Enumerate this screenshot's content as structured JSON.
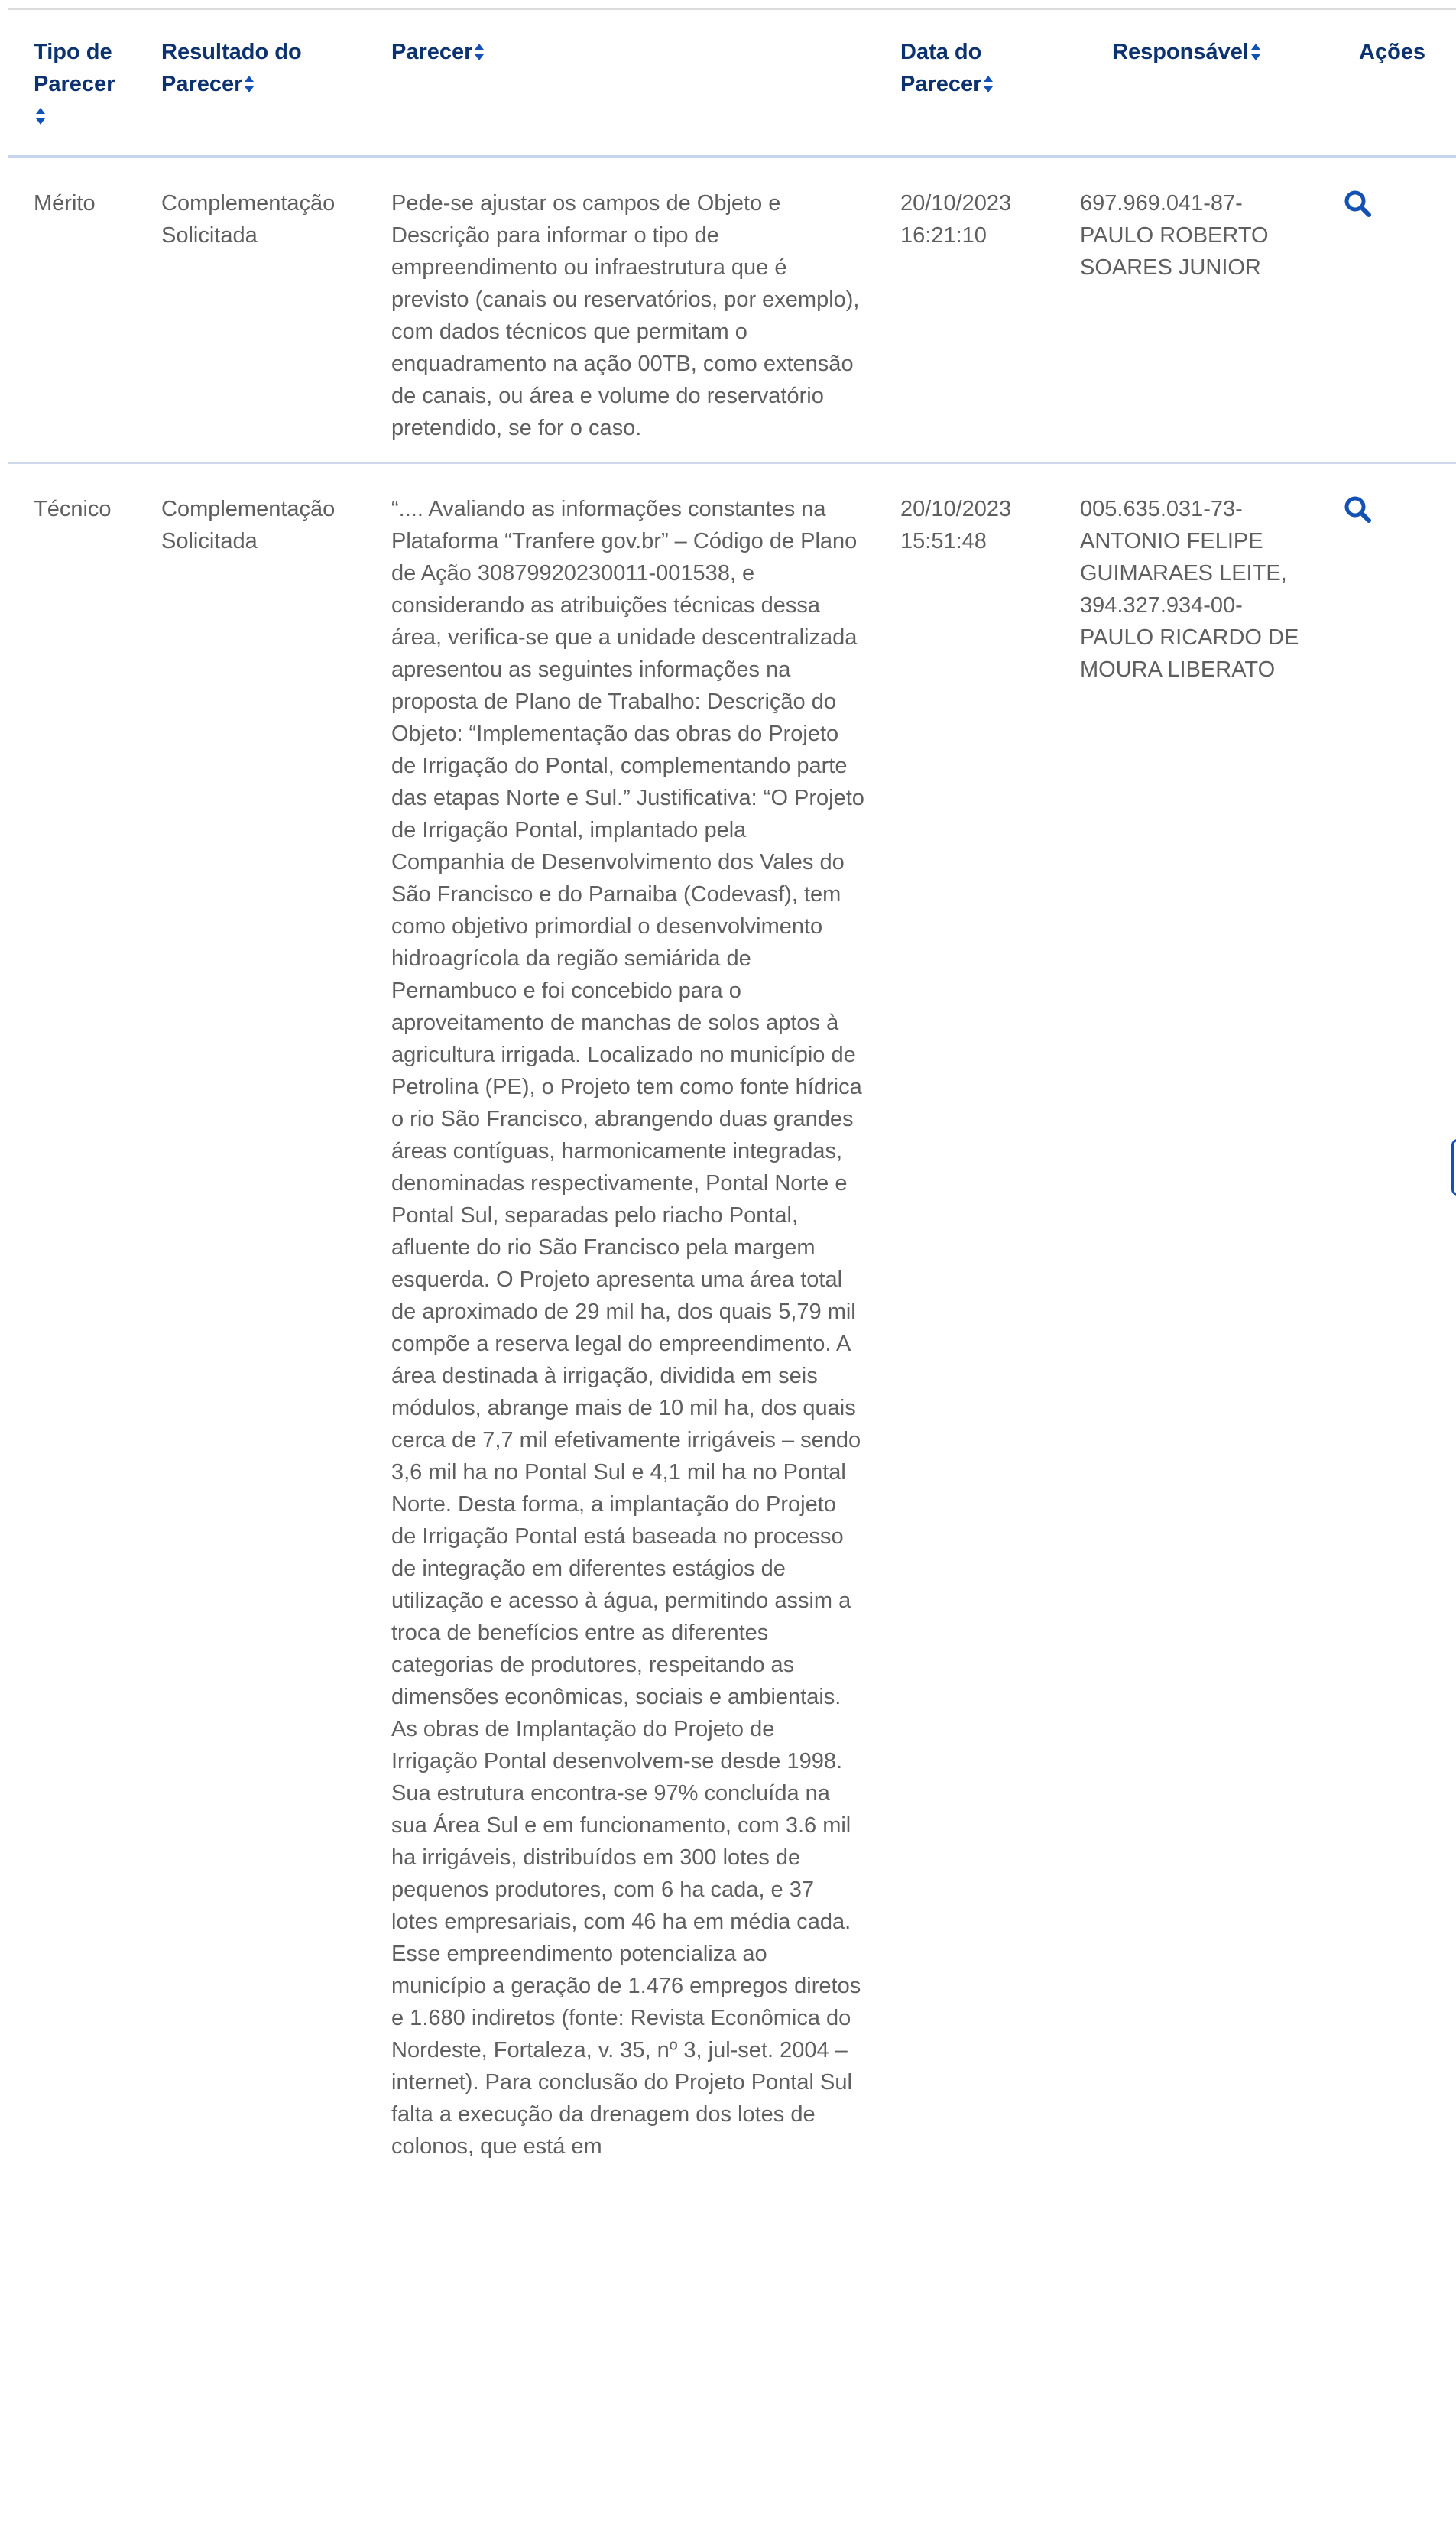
{
  "table": {
    "headers": {
      "tipo": "Tipo de Parecer",
      "resultado": "Resultado do Parecer",
      "parecer": "Parecer",
      "data": "Data do Parecer",
      "responsavel": "Responsável",
      "acoes": "Ações"
    },
    "rows": [
      {
        "tipo": "Mérito",
        "resultado": "Complementação Solicitada",
        "parecer": "Pede-se ajustar os campos de Objeto e Descrição para informar o tipo de empreendimento ou infraestrutura que é previsto (canais ou reservatórios, por exemplo), com dados técnicos que permitam o enquadramento na ação 00TB, como extensão de canais, ou área e volume do reservatório pretendido, se for o caso.",
        "data": "20/10/2023 16:21:10",
        "responsavel": "697.969.041-87- PAULO ROBERTO SOARES JUNIOR"
      },
      {
        "tipo": "Técnico",
        "resultado": "Complementação Solicitada",
        "parecer": "“.... Avaliando as informações constantes na Plataforma “Tranfere gov.br” – Código de Plano de Ação 30879920230011-001538, e considerando as atribuições técnicas dessa área, verifica-se que a unidade descentralizada apresentou as seguintes informações na proposta de Plano de Trabalho: Descrição do Objeto: “Implementação das obras do Projeto de Irrigação do Pontal, complementando parte das etapas Norte e Sul.” Justificativa: “O Projeto de Irrigação Pontal, implantado pela Companhia de Desenvolvimento dos Vales do São Francisco e do Parnaiba (Codevasf), tem como objetivo primordial o desenvolvimento hidroagrícola da região semiárida de Pernambuco e foi concebido para o aproveitamento de manchas de solos aptos à agricultura irrigada. Localizado no município de Petrolina (PE), o Projeto tem como fonte hídrica o rio São Francisco, abrangendo duas grandes áreas contíguas, harmonicamente integradas, denominadas respectivamente, Pontal Norte e Pontal Sul, separadas pelo riacho Pontal, afluente do rio São Francisco pela margem esquerda. O Projeto apresenta uma área total de aproximado de 29 mil ha, dos quais 5,79 mil compõe a reserva legal do empreendimento. A área destinada à irrigação, dividida em seis módulos, abrange mais de 10 mil ha, dos quais cerca de 7,7 mil efetivamente irrigáveis – sendo 3,6 mil ha no Pontal Sul e 4,1 mil ha no Pontal Norte. Desta forma, a implantação do Projeto de Irrigação Pontal está baseada no processo de integração em diferentes estágios de utilização e acesso à água, permitindo assim a troca de benefícios entre as diferentes categorias de produtores, respeitando as dimensões econômicas, sociais e ambientais. As obras de Implantação do Projeto de Irrigação Pontal desenvolvem-se desde 1998. Sua estrutura encontra-se 97% concluída na sua Área Sul e em funcionamento, com 3.6 mil ha irrigáveis, distribuídos em 300 lotes de pequenos produtores, com 6 ha cada, e 37 lotes empresariais, com 46 ha em média cada. Esse empreendimento potencializa ao município a geração de 1.476 empregos diretos e 1.680 indiretos (fonte: Revista Econômica do Nordeste, Fortaleza, v. 35, nº 3, jul-set. 2004 – internet). Para conclusão do Projeto Pontal Sul falta a execução da drenagem dos lotes de colonos, que está em",
        "data": "20/10/2023 15:51:48",
        "responsavel": "005.635.031-73- ANTONIO FELIPE GUIMARAES LEITE, 394.327.934-00- PAULO RICARDO DE MOURA LIBERATO"
      }
    ]
  },
  "icons": {
    "sort": "sort-icon",
    "action": "search-icon"
  },
  "colors": {
    "header_text": "#0c326f",
    "body_text": "#5f5f5f",
    "accent": "#1351b4",
    "divider": "#cfd9ea"
  }
}
